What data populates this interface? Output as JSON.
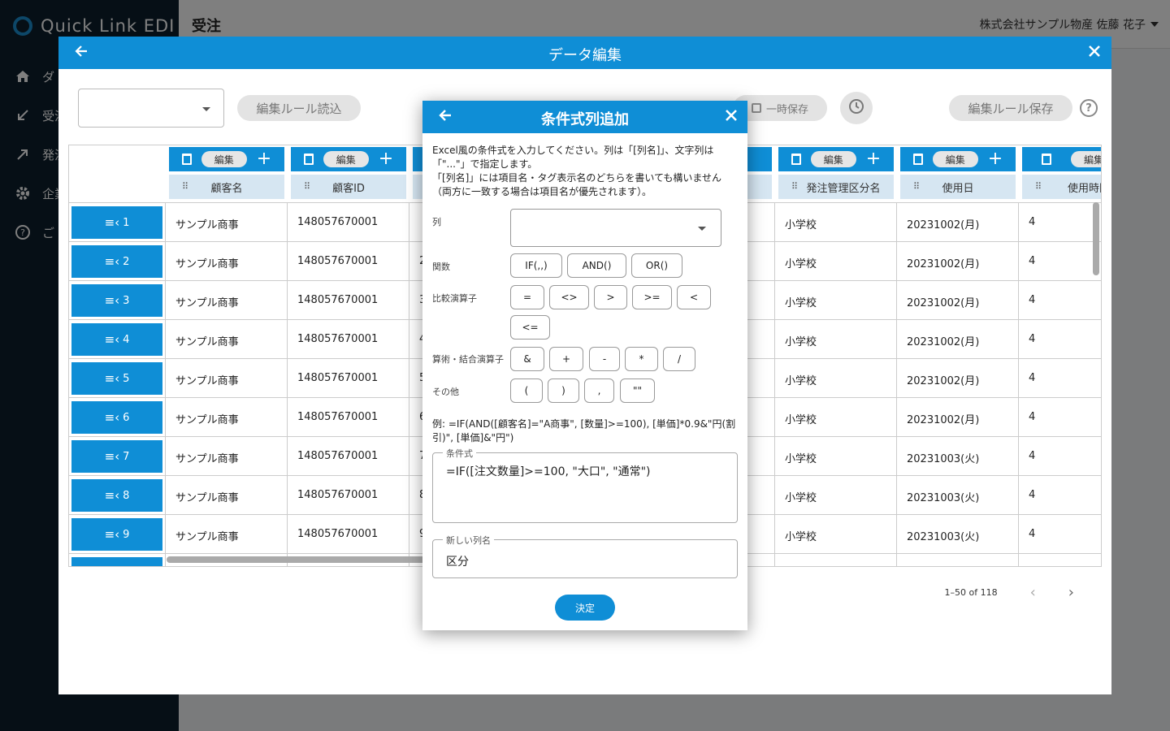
{
  "app": {
    "logo": "Quick Link EDI"
  },
  "sidebar": {
    "items": [
      {
        "label": "ダ",
        "icon": "home-icon"
      },
      {
        "label": "受注",
        "icon": "inbound-arrow-icon"
      },
      {
        "label": "発注",
        "icon": "outbound-arrow-icon"
      },
      {
        "label": "企業",
        "icon": "gear-icon"
      },
      {
        "label": "ご",
        "icon": "help-icon"
      }
    ]
  },
  "topbar": {
    "title": "受注",
    "user": "株式会社サンプル物産 佐藤 花子"
  },
  "data_edit": {
    "title": "データ編集",
    "toolbar": {
      "load_rules": "編集ルール読込",
      "temp_save": "一時保存",
      "save_rules": "編集ルール保存",
      "help": "?"
    },
    "columns": [
      {
        "edit": "編集",
        "name": "顧客名"
      },
      {
        "edit": "編集",
        "name": "顧客ID"
      },
      {
        "edit": "編集",
        "name": "発注管理区分名"
      },
      {
        "edit": "編集",
        "name": "使用日"
      },
      {
        "edit": "編集",
        "name": "使用時間"
      }
    ],
    "rows": [
      {
        "n": "1",
        "customer": "サンプル商事",
        "id": "148057670001",
        "c3": "",
        "kubun": "小学校",
        "date": "20231002(月)",
        "time": "4"
      },
      {
        "n": "2",
        "customer": "サンプル商事",
        "id": "148057670001",
        "c3": "2",
        "kubun": "小学校",
        "date": "20231002(月)",
        "time": "4"
      },
      {
        "n": "3",
        "customer": "サンプル商事",
        "id": "148057670001",
        "c3": "3",
        "kubun": "小学校",
        "date": "20231002(月)",
        "time": "4"
      },
      {
        "n": "4",
        "customer": "サンプル商事",
        "id": "148057670001",
        "c3": "4",
        "kubun": "小学校",
        "date": "20231002(月)",
        "time": "4"
      },
      {
        "n": "5",
        "customer": "サンプル商事",
        "id": "148057670001",
        "c3": "5",
        "kubun": "小学校",
        "date": "20231002(月)",
        "time": "4"
      },
      {
        "n": "6",
        "customer": "サンプル商事",
        "id": "148057670001",
        "c3": "6",
        "kubun": "小学校",
        "date": "20231002(月)",
        "time": "4"
      },
      {
        "n": "7",
        "customer": "サンプル商事",
        "id": "148057670001",
        "c3": "7",
        "kubun": "小学校",
        "date": "20231003(火)",
        "time": "4"
      },
      {
        "n": "8",
        "customer": "サンプル商事",
        "id": "148057670001",
        "c3": "8",
        "kubun": "小学校",
        "date": "20231003(火)",
        "time": "4"
      },
      {
        "n": "9",
        "customer": "サンプル商事",
        "id": "148057670001",
        "c3": "9",
        "kubun": "小学校",
        "date": "20231003(火)",
        "time": "4"
      }
    ],
    "pager": "1–50 of 118"
  },
  "cond": {
    "title": "条件式列追加",
    "instr1": "Excel風の条件式を入力してください。列は「[列名]」、文字列は「\"...\"」で指定します。",
    "instr2": "「[列名]」には項目名・タグ表示名のどちらを書いても構いません（両方に一致する場合は項目名が優先されます）。",
    "labels": {
      "column": "列",
      "functions": "関数",
      "comparison": "比較演算子",
      "arithmetic": "算術・結合演算子",
      "other": "その他"
    },
    "column_value": "",
    "functions": [
      "IF(,,)",
      "AND()",
      "OR()"
    ],
    "comparison": [
      "=",
      "<>",
      ">",
      ">=",
      "<",
      "<="
    ],
    "arithmetic": [
      "&",
      "+",
      "-",
      "*",
      "/"
    ],
    "other": [
      "(",
      ")",
      ",",
      "\"\""
    ],
    "example": "例: =IF(AND([顧客名]=\"A商事\", [数量]>=100), [単価]*0.9&\"円(割引)\", [単価]&\"円\")",
    "formula_label": "条件式",
    "formula_value": "=IF([注文数量]>=100, \"大口\", \"通常\")",
    "newname_label": "新しい列名",
    "newname_value": "区分",
    "decide": "決定"
  }
}
